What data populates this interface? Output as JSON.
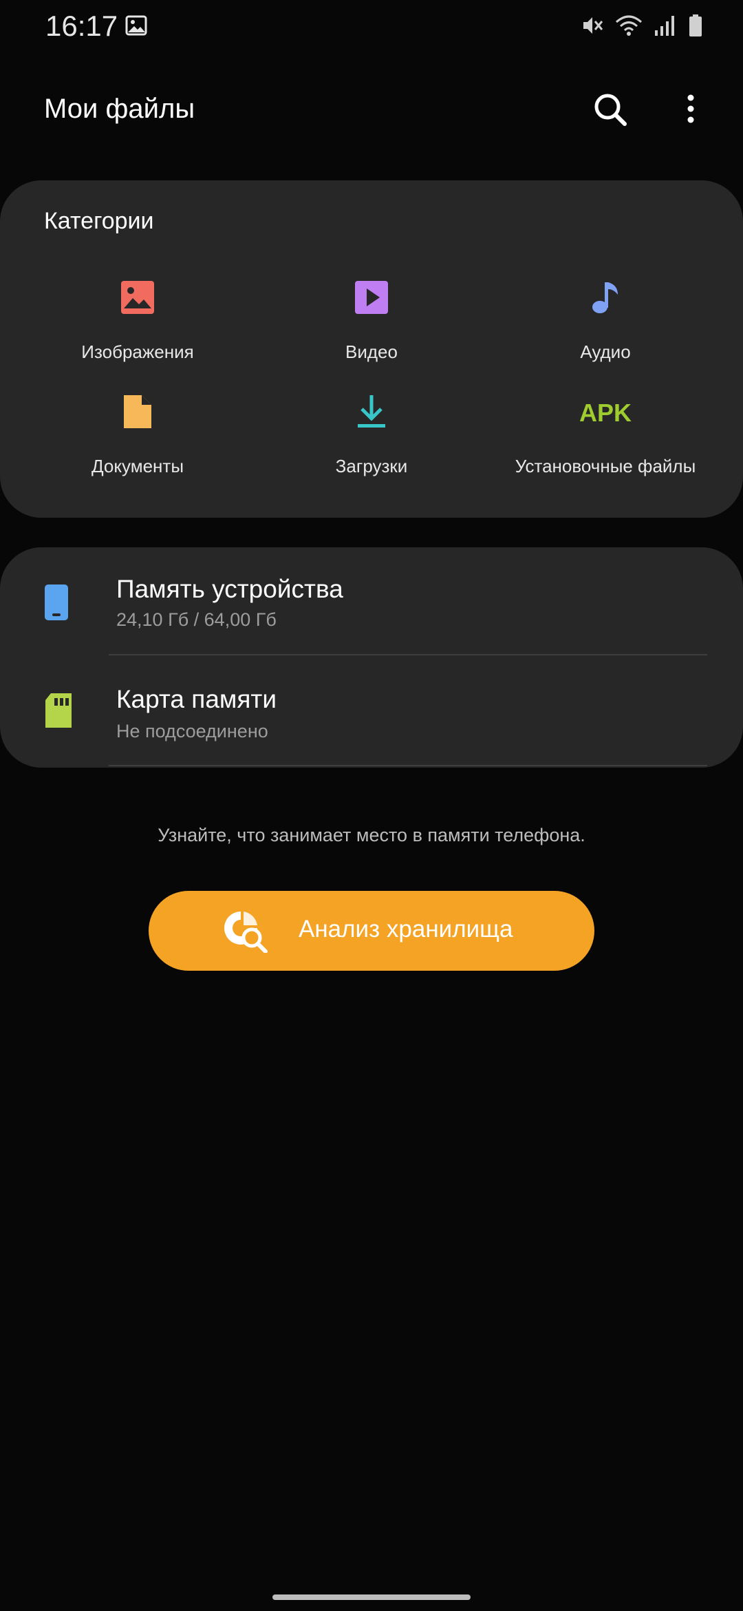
{
  "status_bar": {
    "time": "16:17",
    "icons": [
      "gallery-notification-icon",
      "mute-icon",
      "wifi-icon",
      "signal-icon",
      "battery-icon"
    ]
  },
  "app_bar": {
    "title": "Мои файлы",
    "actions": [
      "search-icon",
      "more-vert-icon"
    ]
  },
  "categories": {
    "title": "Категории",
    "items": [
      {
        "label": "Изображения",
        "icon": "image-icon",
        "color": "#f26b5f"
      },
      {
        "label": "Видео",
        "icon": "video-icon",
        "color": "#bf7ff2"
      },
      {
        "label": "Аудио",
        "icon": "audio-icon",
        "color": "#7fa2f5"
      },
      {
        "label": "Документы",
        "icon": "document-icon",
        "color": "#f7b859"
      },
      {
        "label": "Загрузки",
        "icon": "download-icon",
        "color": "#39c6c9"
      },
      {
        "label": "Установочные файлы",
        "icon": "apk-icon",
        "icon_text": "APK",
        "color": "#9fcc2e"
      }
    ]
  },
  "storage": {
    "items": [
      {
        "name": "Память устройства",
        "detail": "24,10 Гб / 64,00 Гб",
        "icon": "phone-storage-icon",
        "color": "#5aa4f0"
      },
      {
        "name": "Карта памяти",
        "detail": "Не подсоединено",
        "icon": "sd-card-icon",
        "color": "#b4d44a"
      }
    ]
  },
  "hint": "Узнайте, что занимает место в памяти телефона.",
  "analyze_button": {
    "label": "Анализ хранилища",
    "icon": "storage-analysis-icon",
    "color": "#f4a325"
  }
}
